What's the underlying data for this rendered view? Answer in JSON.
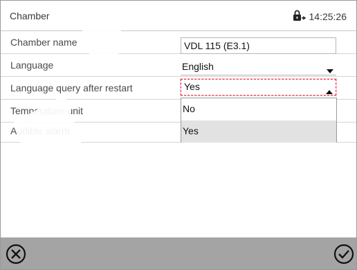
{
  "header": {
    "title": "Chamber",
    "time": "14:25:26",
    "lock_icon": "lock-icon"
  },
  "settings": [
    {
      "label": "Chamber name",
      "value": "VDL 115 (E3.1)"
    },
    {
      "label": "Language",
      "value": "English"
    },
    {
      "label": "Language query after restart",
      "value": "Yes"
    },
    {
      "label": "Temperature unit"
    },
    {
      "label": "Audible alarm"
    }
  ],
  "dropdown": {
    "options": [
      "No",
      "Yes"
    ],
    "selected": "Yes"
  },
  "footer": {
    "cancel_icon": "close-circle-icon",
    "confirm_icon": "check-circle-icon"
  },
  "colors": {
    "footer_bg": "#a4a4a4",
    "active_border": "#e0283c",
    "selected_option_bg": "#e2e2e2"
  }
}
